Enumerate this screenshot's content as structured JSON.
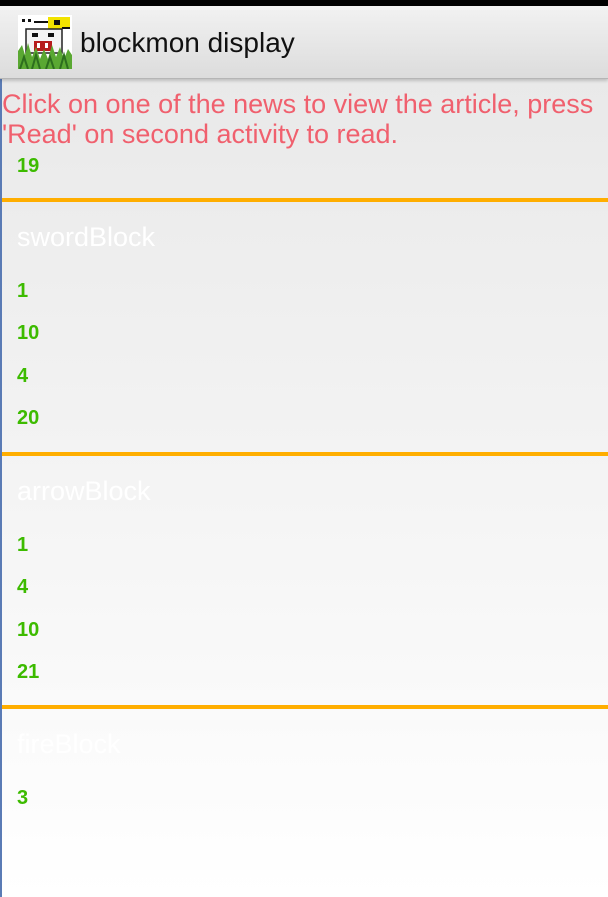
{
  "app": {
    "title": "blockmon display",
    "icon": "blockmon-app-icon"
  },
  "instruction": "Click on one of the news to view the article, press 'Read' on second activity to read.",
  "header_stat": "19",
  "cards": [
    {
      "title": "swordBlock",
      "stats": [
        "1",
        "10",
        "4",
        "20"
      ]
    },
    {
      "title": "arrowBlock",
      "stats": [
        "1",
        "4",
        "10",
        "21"
      ]
    },
    {
      "title": "fireBlock",
      "stats": [
        "3"
      ]
    }
  ],
  "colors": {
    "accent_divider": "#ffae00",
    "stat_green": "#3dbb00",
    "instruction_red": "#f0606e"
  }
}
